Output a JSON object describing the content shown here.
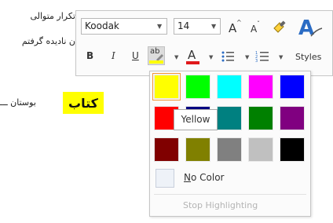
{
  "document": {
    "line1": "تکرار متوالی",
    "line2": "ن نادیده گرفتم",
    "highlighted_word": "کتاب",
    "line3": "بوستان ـــ"
  },
  "toolbar": {
    "font_name": "Koodak",
    "font_size": "14",
    "grow_font": "A",
    "shrink_font": "A",
    "bold": "B",
    "italic": "I",
    "underline": "U",
    "highlight_glyph": "ab",
    "font_color_glyph": "A",
    "styles_label": "Styles"
  },
  "palette": {
    "swatches": [
      {
        "color": "#ffff00"
      },
      {
        "color": "#00ff00"
      },
      {
        "color": "#00ffff"
      },
      {
        "color": "#ff00ff"
      },
      {
        "color": "#0000ff"
      },
      {
        "color": "#ff0000"
      },
      {
        "color": "#000080"
      },
      {
        "color": "#008080"
      },
      {
        "color": "#008000"
      },
      {
        "color": "#800080"
      },
      {
        "color": "#800000"
      },
      {
        "color": "#808000"
      },
      {
        "color": "#808080"
      },
      {
        "color": "#c0c0c0"
      },
      {
        "color": "#000000"
      }
    ],
    "tooltip": "Yellow",
    "no_color_label": "No Color",
    "no_color_underline_char": "N",
    "no_color_rest": "o Color",
    "stop_label": "Stop Highlighting"
  },
  "colors": {
    "highlight_accent": "#ffff00",
    "font_color_accent": "#e0191b",
    "styles_accent": "#2b6cc4"
  }
}
